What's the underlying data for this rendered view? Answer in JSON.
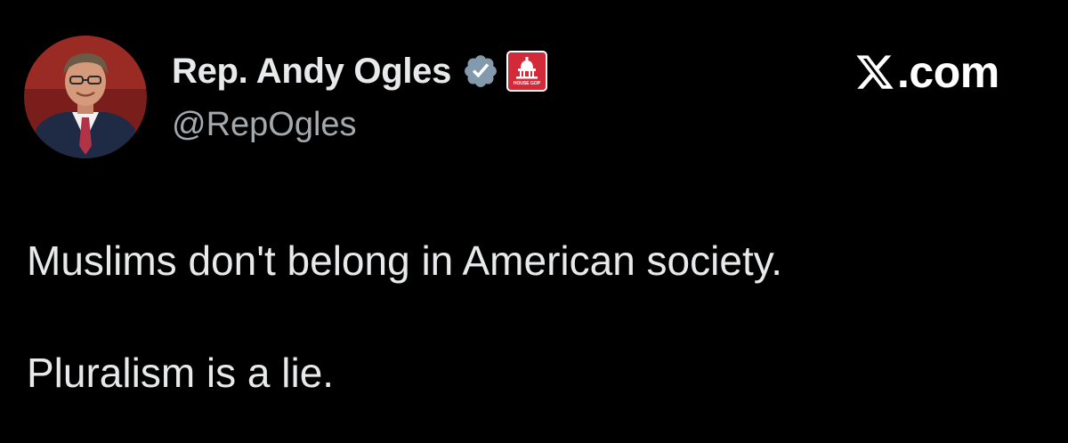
{
  "author": {
    "display_name": "Rep. Andy Ogles",
    "handle": "@RepOgles",
    "avatar_icon": "profile-photo",
    "verified_icon": "verified-checkmark-icon",
    "affiliation_icon": "house-gop-capitol-icon",
    "affiliation_badge_text": "HOUSE GOP"
  },
  "branding": {
    "logo_icon": "x-logo-icon",
    "site_text": ".com"
  },
  "tweet": {
    "lines": [
      "Muslims don't belong in American society.",
      "Pluralism is a lie."
    ]
  },
  "colors": {
    "background": "#000000",
    "text_primary": "#e7e9ea",
    "text_secondary": "#a4a9ae",
    "verified_badge": "#829aab",
    "affiliation_red": "#d32a3a"
  }
}
